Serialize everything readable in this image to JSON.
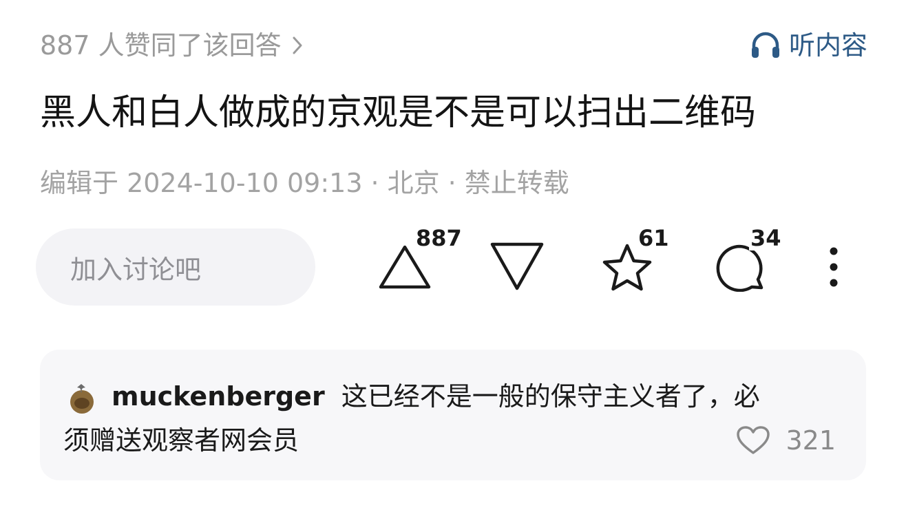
{
  "header": {
    "upvote_summary": "887 人赞同了该回答",
    "listen_label": "听内容"
  },
  "question": {
    "title": "黑人和白人做成的京观是不是可以扫出二维码"
  },
  "meta": {
    "edited": "编辑于 2024-10-10 09:13",
    "separator": "·",
    "location": "北京",
    "rights": "禁止转载"
  },
  "actions": {
    "discussion_placeholder": "加入讨论吧",
    "upvote_count": "887",
    "favorite_count": "61",
    "comment_count": "34",
    "icons": [
      "upvote-triangle-icon",
      "downvote-triangle-icon",
      "star-icon",
      "comment-bubble-icon",
      "more-vertical-icon"
    ]
  },
  "top_comment": {
    "username": "muckenberger",
    "text_line1": "这已经不是一般的保守主义者了，必",
    "text_line2": "须赠送观察者网会员",
    "likes": "321"
  },
  "colors": {
    "accent_blue": "#2d5a86",
    "muted_text": "#9a9a9a",
    "pill_bg": "#f3f3f6",
    "card_bg": "#f7f7f9"
  }
}
